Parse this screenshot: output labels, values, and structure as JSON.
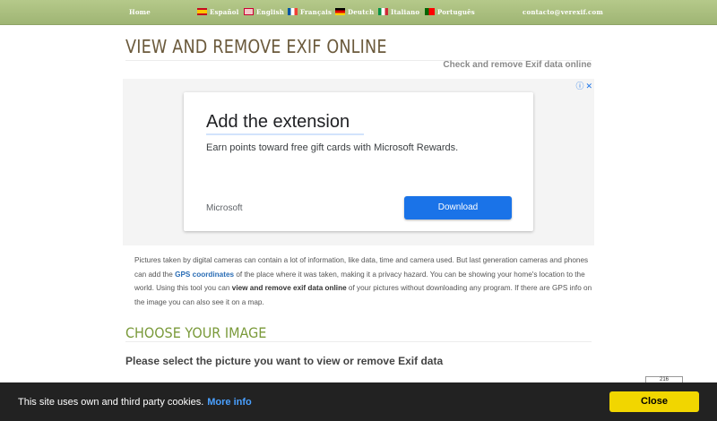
{
  "nav": {
    "home": "Home",
    "languages": [
      {
        "label": "Español",
        "flag": "es"
      },
      {
        "label": "English",
        "flag": "en"
      },
      {
        "label": "Français",
        "flag": "fr"
      },
      {
        "label": "Deutch",
        "flag": "de"
      },
      {
        "label": "Italiano",
        "flag": "it"
      },
      {
        "label": "Português",
        "flag": "pt"
      }
    ],
    "contact": "contacto@verexif.com"
  },
  "page": {
    "title": "VIEW AND REMOVE EXIF ONLINE",
    "subtitle": "Check and remove Exif data online"
  },
  "ad": {
    "headline": "Add the extension",
    "description": "Earn points toward free gift cards with Microsoft Rewards.",
    "brand": "Microsoft",
    "cta": "Download",
    "info_icon": "ⓘ",
    "close_icon": "✕"
  },
  "intro": {
    "p1": "Pictures taken by digital cameras can contain a lot of information, like data, time and camera used. But last generation cameras and phones can add the ",
    "link": "GPS coordinates",
    "p2": " of the place where it was taken, making it a privacy hazard. You can be showing your home's location to the world. Using this tool you can ",
    "bold": "view and remove exif data online",
    "p3": " of your pictures without downloading any program. If there are GPS info on the image you can also see it on a map."
  },
  "section": {
    "heading": "CHOOSE YOUR IMAGE",
    "prompt": "Please select the picture you want to view or remove Exif data"
  },
  "badge": {
    "text": "216"
  },
  "cookie": {
    "text": "This site uses own and third party cookies.",
    "more_info": "More info",
    "close": "Close"
  },
  "colors": {
    "nav_bg": "#a9bf80",
    "title": "#6b5a3c",
    "section": "#7a9a3a",
    "link": "#2a6db5",
    "cookie_bg": "#222222",
    "close_bg": "#f1d600",
    "ad_button": "#1a73e8"
  }
}
